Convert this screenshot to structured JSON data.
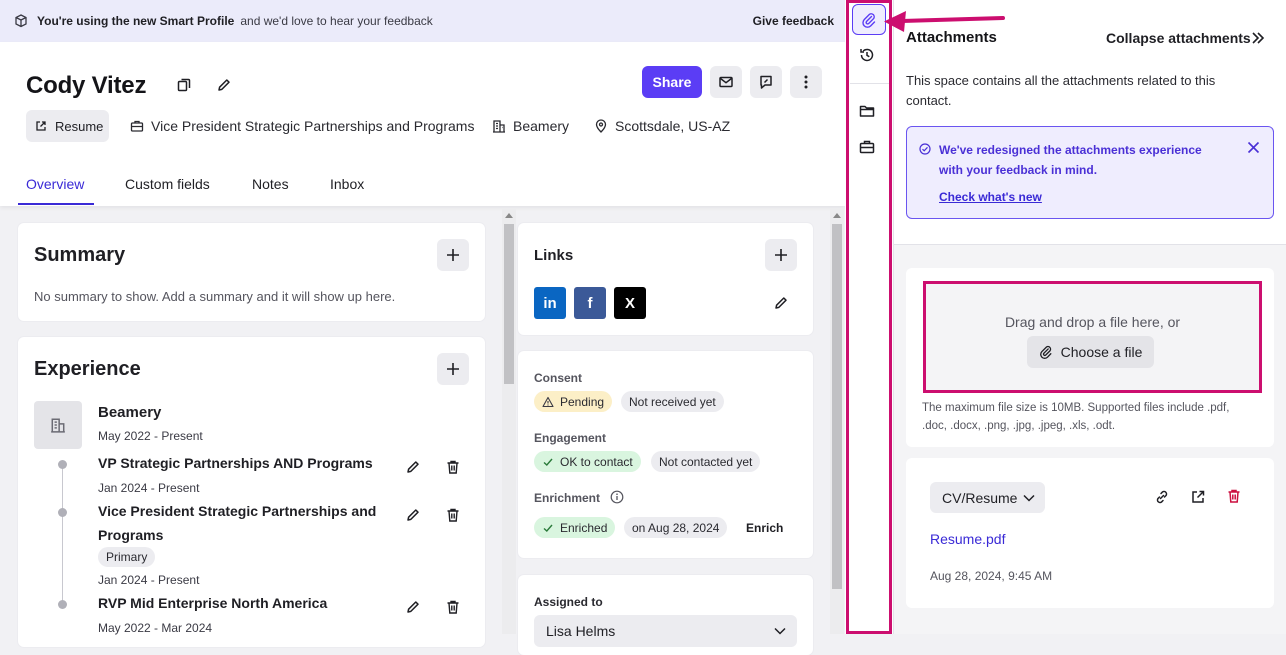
{
  "banner": {
    "bold_text": "You're using the new Smart Profile",
    "text": "and we'd love to hear your feedback",
    "feedback": "Give feedback"
  },
  "profile": {
    "name": "Cody Vitez",
    "share": "Share",
    "resume": "Resume",
    "title": "Vice President Strategic Partnerships and Programs",
    "company": "Beamery",
    "location": "Scottsdale, US-AZ"
  },
  "tabs": [
    "Overview",
    "Custom fields",
    "Notes",
    "Inbox"
  ],
  "summary": {
    "title": "Summary",
    "empty": "No summary to show. Add a summary and it will show up here."
  },
  "experience": {
    "title": "Experience",
    "company": "Beamery",
    "company_dates": "May 2022 - Present",
    "roles": [
      {
        "title": "VP Strategic Partnerships AND Programs",
        "dates": "Jan 2024 - Present"
      },
      {
        "title_line1": "Vice President Strategic Partnerships and",
        "title_line2": "Programs",
        "badge": "Primary",
        "dates": "Jan 2024 - Present"
      },
      {
        "title": "RVP Mid Enterprise North America",
        "dates": "May 2022 - Mar 2024"
      }
    ]
  },
  "links": {
    "title": "Links",
    "items": [
      "in",
      "f",
      "X"
    ]
  },
  "status": {
    "consent_label": "Consent",
    "consent_pending": "Pending",
    "consent_info": "Not received yet",
    "engagement_label": "Engagement",
    "engagement_ok": "OK to contact",
    "engagement_info": "Not contacted yet",
    "enrichment_label": "Enrichment",
    "enrichment_ok": "Enriched",
    "enrichment_date": "on Aug 28, 2024",
    "enrich_action": "Enrich"
  },
  "assigned": {
    "label": "Assigned to",
    "value": "Lisa Helms"
  },
  "attachments": {
    "title": "Attachments",
    "collapse": "Collapse attachments",
    "description": "This space contains all the attachments related to this contact.",
    "notice": "We've redesigned the attachments experience with your feedback in mind.",
    "notice_link": "Check what's new",
    "drop_text": "Drag and drop a file here, or",
    "choose": "Choose a file",
    "max_size": "The maximum file size is 10MB. Supported files include .pdf, .doc, .docx, .png, .jpg, .jpeg, .xls, .odt.",
    "file_type": "CV/Resume",
    "file_name": "Resume.pdf",
    "file_date": "Aug 28, 2024, 9:45 AM"
  },
  "colors": {
    "accent": "#5b3df5",
    "highlight": "#cc0e6f",
    "linkedin": "#0a66c2",
    "facebook": "#3b5998",
    "x": "#000000"
  }
}
